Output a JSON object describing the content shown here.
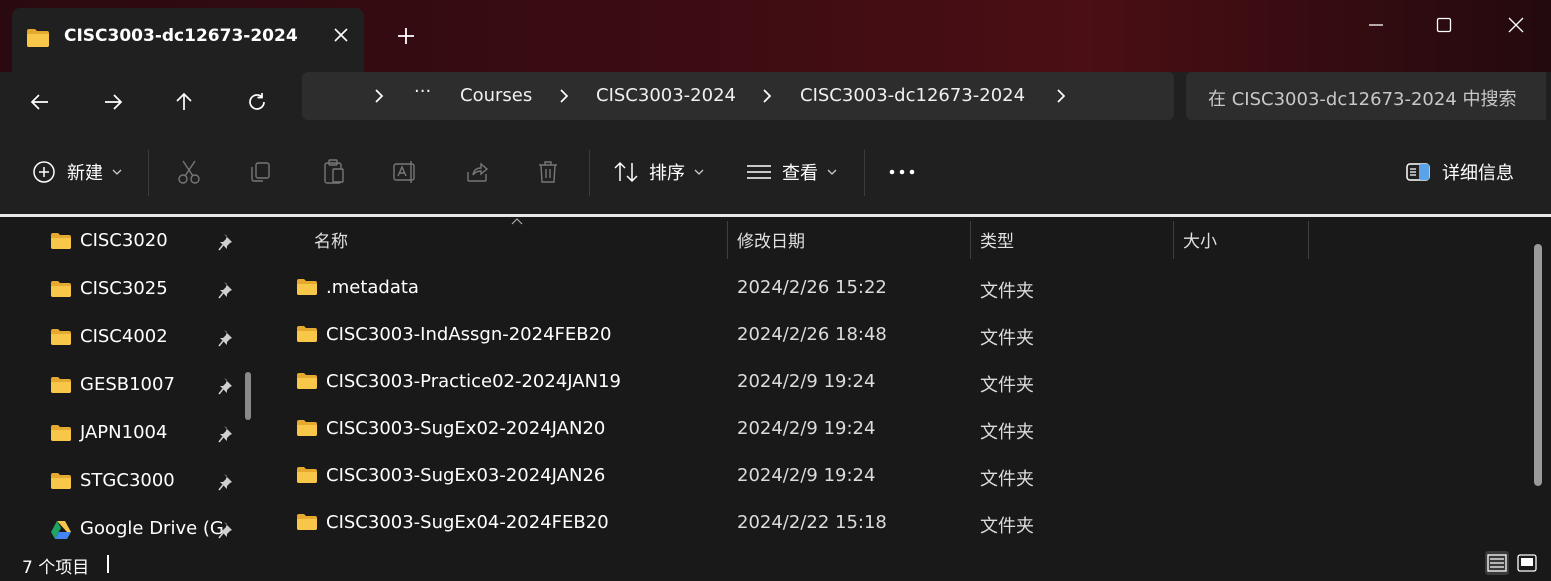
{
  "window": {
    "tab_title": "CISC3003-dc12673-2024",
    "new_tab_label": "+"
  },
  "nav": {
    "breadcrumb": [
      "Courses",
      "CISC3003-2024",
      "CISC3003-dc12673-2024"
    ],
    "overflow_label": "···",
    "search_placeholder": "在 CISC3003-dc12673-2024 中搜索"
  },
  "toolbar": {
    "new_label": "新建",
    "sort_label": "排序",
    "view_label": "查看",
    "more_label": "•••",
    "details_label": "详细信息"
  },
  "sidebar": {
    "items": [
      {
        "label": "CISC3020",
        "icon": "folder-icon",
        "pinned": true
      },
      {
        "label": "CISC3025",
        "icon": "folder-icon",
        "pinned": true
      },
      {
        "label": "CISC4002",
        "icon": "folder-icon",
        "pinned": true
      },
      {
        "label": "GESB1007",
        "icon": "folder-icon",
        "pinned": true
      },
      {
        "label": "JAPN1004",
        "icon": "folder-icon",
        "pinned": true
      },
      {
        "label": "STGC3000",
        "icon": "folder-icon",
        "pinned": true
      },
      {
        "label": "Google Drive (G",
        "icon": "google-drive-icon",
        "pinned": true
      }
    ]
  },
  "columns": {
    "name": "名称",
    "modified": "修改日期",
    "type": "类型",
    "size": "大小"
  },
  "files": [
    {
      "name": ".metadata",
      "modified": "2024/2/26 15:22",
      "type": "文件夹"
    },
    {
      "name": "CISC3003-IndAssgn-2024FEB20",
      "modified": "2024/2/26 18:48",
      "type": "文件夹"
    },
    {
      "name": "CISC3003-Practice02-2024JAN19",
      "modified": "2024/2/9 19:24",
      "type": "文件夹"
    },
    {
      "name": "CISC3003-SugEx02-2024JAN20",
      "modified": "2024/2/9 19:24",
      "type": "文件夹"
    },
    {
      "name": "CISC3003-SugEx03-2024JAN26",
      "modified": "2024/2/9 19:24",
      "type": "文件夹"
    },
    {
      "name": "CISC3003-SugEx04-2024FEB20",
      "modified": "2024/2/22 15:18",
      "type": "文件夹"
    }
  ],
  "status": {
    "item_count": "7 个项目"
  },
  "colors": {
    "folder": "#f8c74a",
    "folder_dark": "#e6a92f",
    "background": "#191919",
    "chrome": "#202020"
  }
}
